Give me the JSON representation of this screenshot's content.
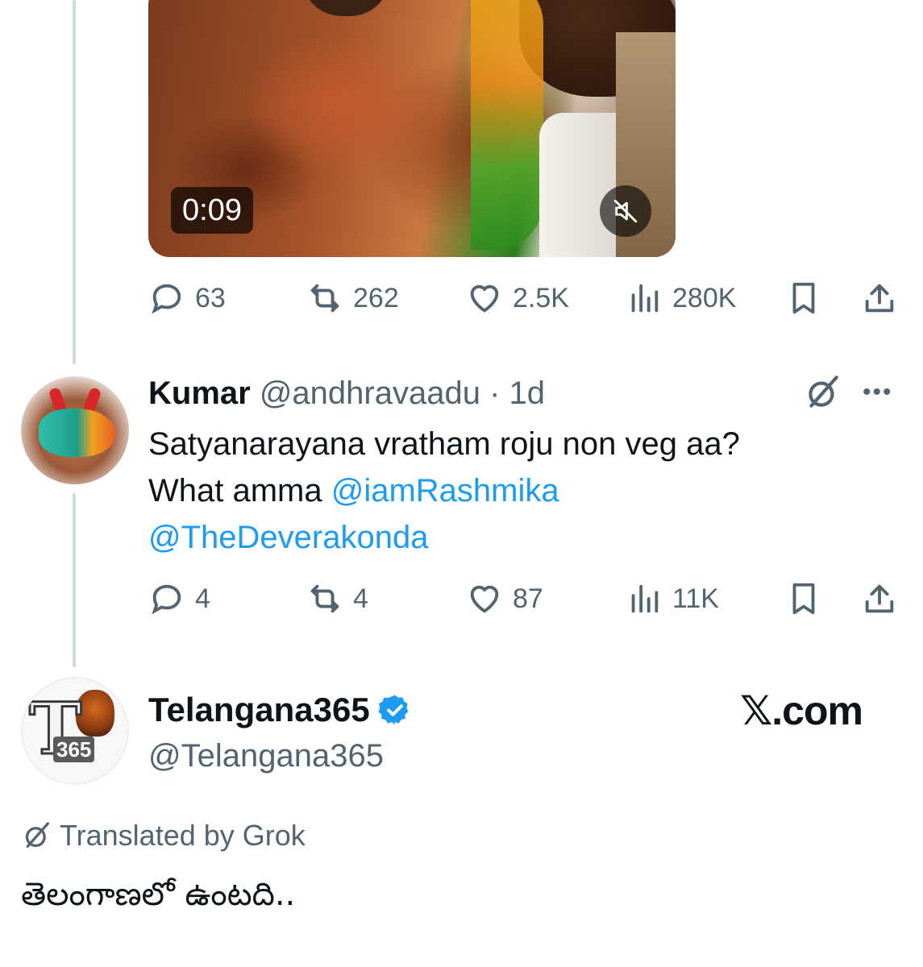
{
  "video": {
    "time": "0:09",
    "mute_icon": "speaker-muted-icon"
  },
  "main_tweet_actions": {
    "replies": "63",
    "reposts": "262",
    "likes": "2.5K",
    "views": "280K"
  },
  "reply": {
    "author_name": "Kumar",
    "handle": "@andhravaadu",
    "separator": "·",
    "time": "1d",
    "text_line1": "Satyanarayana vratham roju non veg aa?",
    "text_line2_prefix": "What amma ",
    "mention1": "@iamRashmika",
    "mention2": "@TheDeverakonda",
    "actions": {
      "replies": "4",
      "reposts": "4",
      "likes": "87",
      "views": "11K"
    }
  },
  "response": {
    "author_name": "Telangana365",
    "handle": "@Telangana365",
    "verified": true,
    "watermark": "𝕏.com",
    "translated_label": "Translated by Grok",
    "text": "తెలంగాణలో ఉంటది.."
  },
  "colors": {
    "text_primary": "#0f1419",
    "text_secondary": "#536471",
    "link": "#1d9bf0",
    "thread_line": "#cfd9de",
    "verified": "#1d9bf0"
  }
}
